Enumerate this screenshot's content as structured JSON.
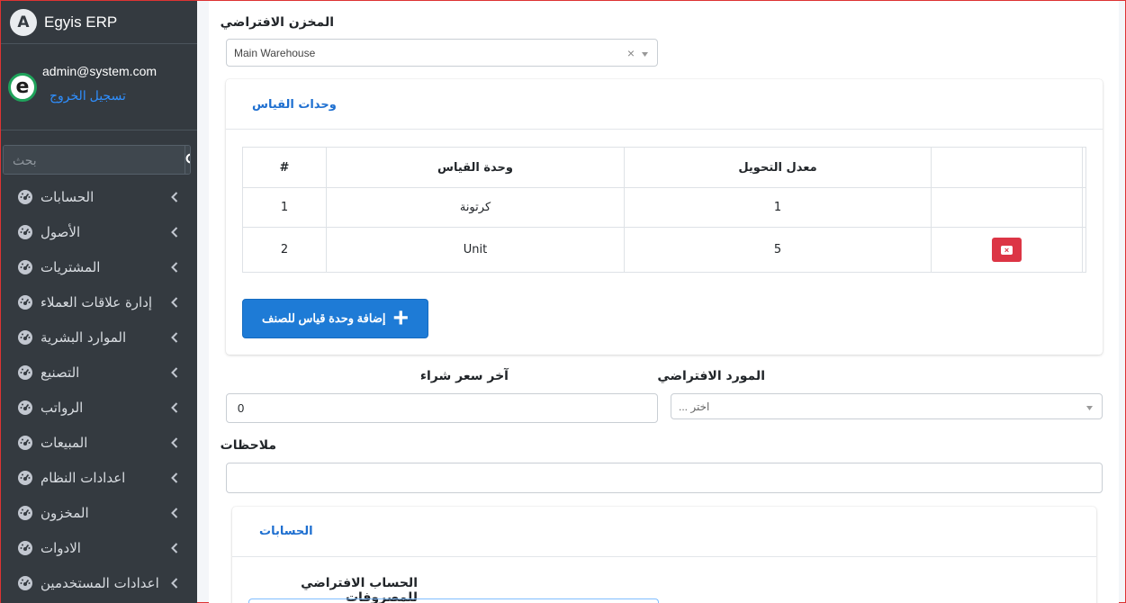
{
  "brand": {
    "name": "Egyis ERP",
    "logo_letter": "A"
  },
  "user": {
    "email": "admin@system.com",
    "logout": "تسجيل الخروج",
    "avatar_letter": "e"
  },
  "search": {
    "placeholder": "بحث"
  },
  "sidebar": {
    "items": [
      {
        "label": "الحسابات"
      },
      {
        "label": "الأصول"
      },
      {
        "label": "المشتريات"
      },
      {
        "label": "إدارة علاقات العملاء"
      },
      {
        "label": "الموارد البشرية"
      },
      {
        "label": "التصنيع"
      },
      {
        "label": "الرواتب"
      },
      {
        "label": "المبيعات"
      },
      {
        "label": "اعدادات النظام"
      },
      {
        "label": "المخزون"
      },
      {
        "label": "الادوات"
      },
      {
        "label": "اعدادات المستخدمين"
      }
    ]
  },
  "form": {
    "default_warehouse": {
      "label": "المخزن الافتراضي",
      "value": "Main Warehouse"
    },
    "units_card": {
      "title": "وحدات القياس",
      "headers": [
        "#",
        "وحدة القياس",
        "معدل التحويل",
        ""
      ],
      "rows": [
        {
          "index": "1",
          "unit": "كرتونة",
          "rate": "1"
        },
        {
          "index": "2",
          "unit": "Unit",
          "rate": "5"
        }
      ],
      "add_button": "إضافة وحدة قياس للصنف"
    },
    "last_purchase_price": {
      "label": "آخر سعر شراء",
      "value": "0"
    },
    "default_supplier": {
      "label": "المورد الافتراضي",
      "placeholder": "... اختر"
    },
    "notes": {
      "label": "ملاحظات",
      "value": ""
    },
    "accounts_card": {
      "title": "الحسابات"
    },
    "default_expense_account": {
      "label": "الحساب الافتراضي للمصروفات"
    }
  },
  "colors": {
    "sidebar_bg": "#343a40",
    "accent": "#1e7bd6",
    "danger": "#dc3545",
    "link": "#2f8fff"
  }
}
